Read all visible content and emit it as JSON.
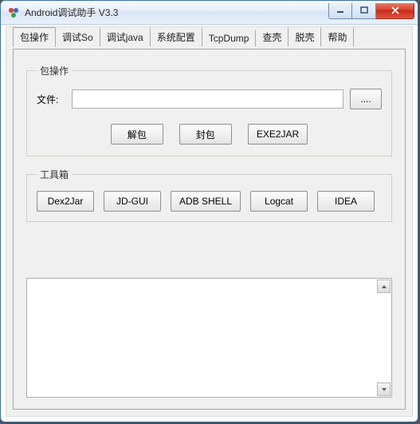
{
  "window": {
    "title": "Android调试助手 V3.3"
  },
  "tabs": [
    {
      "label": "包操作",
      "active": true
    },
    {
      "label": "调试So",
      "active": false
    },
    {
      "label": "调试java",
      "active": false
    },
    {
      "label": "系统配置",
      "active": false
    },
    {
      "label": "TcpDump",
      "active": false
    },
    {
      "label": "查壳",
      "active": false
    },
    {
      "label": "脱壳",
      "active": false
    },
    {
      "label": "帮助",
      "active": false
    }
  ],
  "packageOps": {
    "legend": "包操作",
    "fileLabel": "文件:",
    "fileValue": "",
    "browseLabel": "....",
    "unpackLabel": "解包",
    "packLabel": "封包",
    "exe2jarLabel": "EXE2JAR"
  },
  "toolbox": {
    "legend": "工具箱",
    "buttons": [
      "Dex2Jar",
      "JD-GUI",
      "ADB SHELL",
      "Logcat",
      "IDEA"
    ]
  },
  "logArea": {
    "content": ""
  }
}
